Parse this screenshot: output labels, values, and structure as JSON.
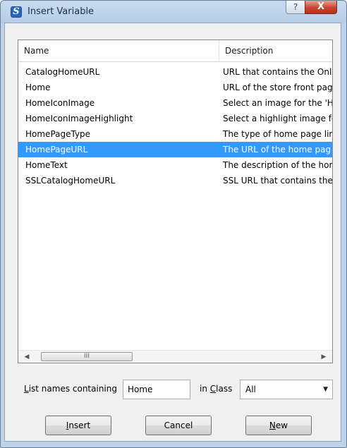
{
  "window": {
    "title": "Insert Variable",
    "help_glyph": "?",
    "close_glyph": "X"
  },
  "list": {
    "columns": [
      "Name",
      "Description"
    ],
    "rows": [
      {
        "name": "CatalogHomeURL",
        "description": "URL that contains the Onl"
      },
      {
        "name": "Home",
        "description": "URL of the store front pag"
      },
      {
        "name": "HomeIconImage",
        "description": "Select an image for the 'H"
      },
      {
        "name": "HomeIconImageHighlight",
        "description": "Select a highlight image fo"
      },
      {
        "name": "HomePageType",
        "description": "The type of home page lir"
      },
      {
        "name": "HomePageURL",
        "description": "The URL of the home pag"
      },
      {
        "name": "HomeText",
        "description": "The description of the hor"
      },
      {
        "name": "SSLCatalogHomeURL",
        "description": "SSL URL that contains the"
      }
    ],
    "selected_index": 5,
    "scroll": {
      "left_glyph": "◀",
      "right_glyph": "▶",
      "thumb_glyph": "III"
    }
  },
  "filter": {
    "list_names_first": "L",
    "list_names_rest": "ist names containing",
    "search_value": "Home",
    "in_class_prefix": "in ",
    "in_class_u": "C",
    "in_class_rest": "lass",
    "class_value": "All",
    "class_arrow": "▼"
  },
  "buttons": {
    "insert_u": "I",
    "insert_rest": "nsert",
    "cancel": "Cancel",
    "new_u": "N",
    "new_rest": "ew"
  },
  "colors": {
    "selection": "#3399ff",
    "frame": "#bcd3ea",
    "close_button": "#c9442f"
  }
}
